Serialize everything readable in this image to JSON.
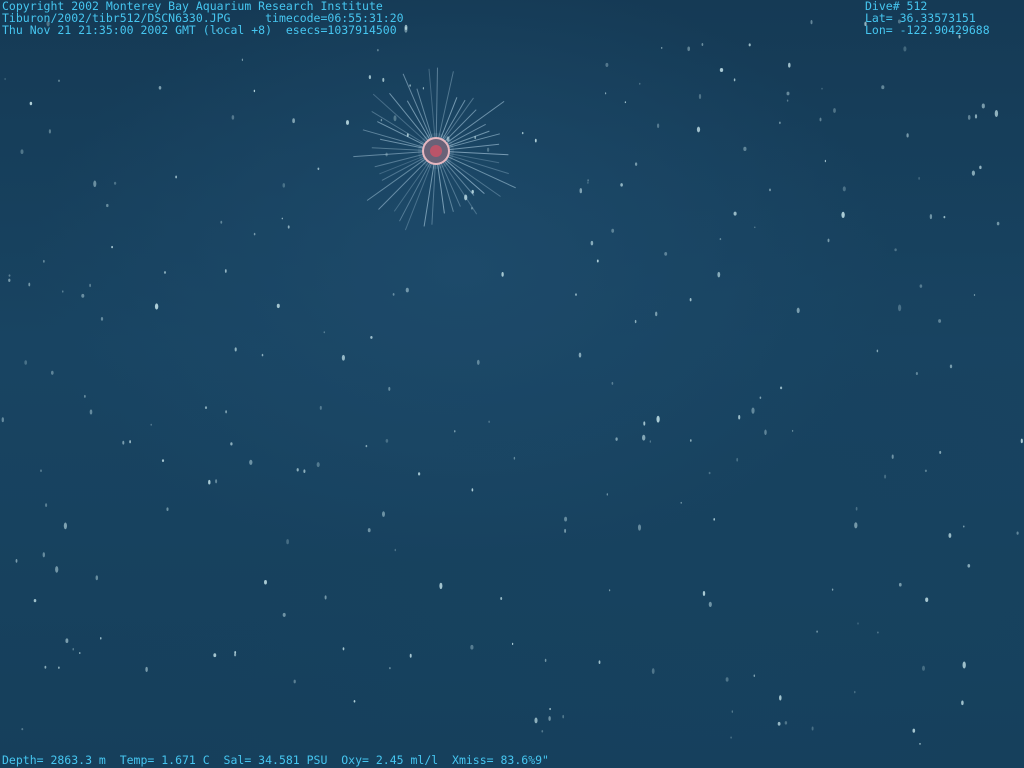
{
  "image": {
    "scene": "deep-sea water column with a single small jellyfish and marine snow",
    "subject_icon": "jellyfish-icon",
    "colors": {
      "water": "#184462",
      "overlay_text": "#46c6f0",
      "jelly_body": "#e07f88",
      "jelly_tentacles": "#b7d7ea"
    }
  },
  "overlay": {
    "header_left": [
      "Copyright 2002 Monterey Bay Aquarium Research Institute",
      "Tiburon/2002/tibr512/DSCN6330.JPG     timecode=06:55:31:20",
      "Thu Nov 21 21:35:00 2002 GMT (local +8)  esecs=1037914500"
    ],
    "header_right": [
      "Dive# 512",
      "Lat= 36.33573151",
      "Lon= -122.90429688"
    ],
    "footer": "Depth= 2863.3 m  Temp= 1.671 C  Sal= 34.581 PSU  Oxy= 2.45 ml/l  Xmiss= 83.6%9\""
  }
}
